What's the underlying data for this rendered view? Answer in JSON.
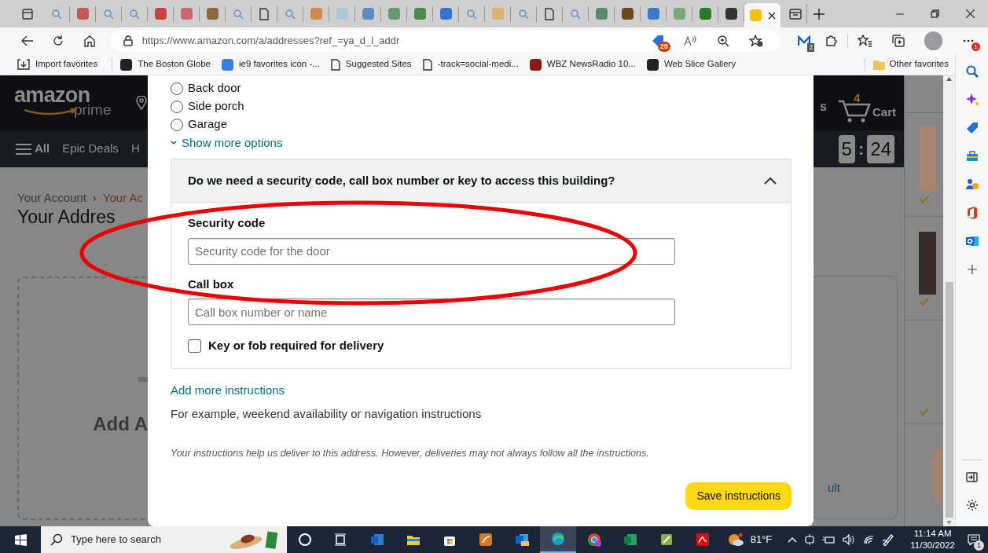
{
  "tab_strip": {
    "tabs": [
      {
        "kind": "search",
        "selected": false
      },
      {
        "kind": "site",
        "color": "#c05a5a",
        "selected": false
      },
      {
        "kind": "search",
        "selected": false
      },
      {
        "kind": "search",
        "selected": false
      },
      {
        "kind": "site",
        "color": "#d04040",
        "selected": false
      },
      {
        "kind": "site",
        "color": "#c86a6a",
        "selected": false
      },
      {
        "kind": "site",
        "color": "#8a6a3a",
        "selected": false
      },
      {
        "kind": "search",
        "selected": false
      },
      {
        "kind": "page",
        "selected": false
      },
      {
        "kind": "search",
        "selected": false
      },
      {
        "kind": "site",
        "color": "#d08a4a",
        "selected": false
      },
      {
        "kind": "site",
        "color": "#b0c4d8",
        "selected": false
      },
      {
        "kind": "site",
        "color": "#5a8ac8",
        "selected": false
      },
      {
        "kind": "site",
        "color": "#6a9a6a",
        "selected": false
      },
      {
        "kind": "site",
        "color": "#4a8a4a",
        "selected": false
      },
      {
        "kind": "site",
        "color": "#3a70d0",
        "selected": false
      },
      {
        "kind": "search",
        "selected": false
      },
      {
        "kind": "site",
        "color": "#e0b070",
        "selected": false
      },
      {
        "kind": "search",
        "selected": false
      },
      {
        "kind": "page",
        "selected": false
      },
      {
        "kind": "search",
        "selected": false
      },
      {
        "kind": "site",
        "color": "#5a8a6a",
        "selected": false
      },
      {
        "kind": "site",
        "color": "#6a4a1a",
        "selected": false
      },
      {
        "kind": "site",
        "color": "#3a7ac8",
        "selected": false
      },
      {
        "kind": "site",
        "color": "#7aa87a",
        "selected": false
      },
      {
        "kind": "site",
        "color": "#2a7a2a",
        "selected": false
      },
      {
        "kind": "site",
        "color": "#333333",
        "selected": false
      },
      {
        "kind": "site",
        "color": "#f5c000",
        "selected": true
      }
    ]
  },
  "toolbar": {
    "url": "https://www.amazon.com/a/addresses?ref_=ya_d_l_addr",
    "coupon_badge": "20",
    "extensions_badge": "2",
    "menu_badge": "1"
  },
  "favorites": [
    {
      "kind": "import",
      "label": "Import favorites"
    },
    {
      "kind": "site",
      "color": "#222222",
      "label": "The Boston Globe"
    },
    {
      "kind": "site",
      "color": "#3b7de0",
      "label": "ie9 favorites icon -..."
    },
    {
      "kind": "page",
      "label": "Suggested Sites"
    },
    {
      "kind": "page",
      "label": "-track=social-medi..."
    },
    {
      "kind": "site",
      "color": "#8a1a1a",
      "label": "WBZ NewsRadio 10..."
    },
    {
      "kind": "site",
      "color": "#222222",
      "label": "Web Slice Gallery"
    }
  ],
  "other_favorites": "Other favorites",
  "background_page": {
    "logo": "amazon",
    "logo_sub": "prime",
    "header_fragment": "s",
    "cart_count": "4",
    "cart_label": "Cart",
    "nav": [
      "All",
      "Epic Deals",
      "H"
    ],
    "timer": [
      "5",
      ":",
      "24"
    ],
    "breadcrumb": [
      "Your Account",
      "›",
      "Your Ac"
    ],
    "heading": "Your Addres",
    "add_card": "Add A",
    "card_fragment": "ult"
  },
  "modal": {
    "radios": [
      {
        "label": "Back door",
        "selected": false
      },
      {
        "label": "Side porch",
        "selected": false
      },
      {
        "label": "Garage",
        "selected": false
      }
    ],
    "show_more": "Show more options",
    "section": {
      "question": "Do we need a security code, call box number or key to access this building?",
      "expanded": true,
      "fields": [
        {
          "label": "Security code",
          "placeholder": "Security code for the door"
        },
        {
          "label": "Call box",
          "placeholder": "Call box number or name"
        }
      ],
      "checkbox": {
        "label": "Key or fob required for delivery",
        "checked": false
      }
    },
    "add_more": "Add more instructions",
    "hint": "For example, weekend availability or navigation instructions",
    "note": "Your instructions help us deliver to this address. However, deliveries may not always follow all the instructions.",
    "save_button": "Save instructions"
  },
  "taskbar": {
    "search_placeholder": "Type here to search",
    "apps": [
      {
        "kind": "cortana",
        "selected": false
      },
      {
        "kind": "taskview",
        "selected": false
      },
      {
        "kind": "word",
        "selected": false
      },
      {
        "kind": "explorer",
        "selected": false
      },
      {
        "kind": "store",
        "selected": false
      },
      {
        "kind": "notes",
        "selected": false
      },
      {
        "kind": "outlook",
        "selected": false
      },
      {
        "kind": "edge",
        "selected": true
      },
      {
        "kind": "chrome",
        "selected": false
      },
      {
        "kind": "excel",
        "selected": false
      },
      {
        "kind": "green",
        "selected": false
      },
      {
        "kind": "acrobat",
        "selected": false
      }
    ],
    "weather": "81°F",
    "time": "11:14 AM",
    "date": "11/30/2022",
    "notifications": "1"
  }
}
